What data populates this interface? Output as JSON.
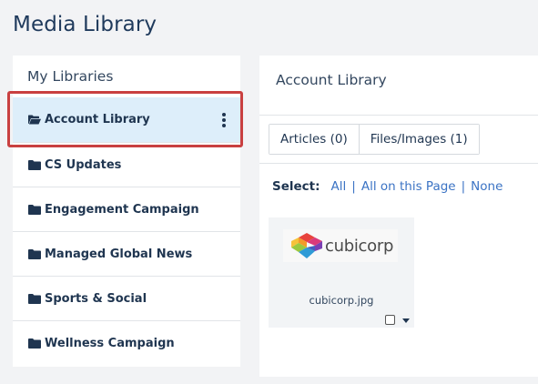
{
  "page": {
    "title": "Media Library"
  },
  "sidebar": {
    "heading": "My Libraries",
    "items": [
      {
        "label": "Account Library",
        "icon": "folder-open-icon",
        "active": true
      },
      {
        "label": "CS Updates",
        "icon": "folder-icon"
      },
      {
        "label": "Engagement Campaign",
        "icon": "folder-icon"
      },
      {
        "label": "Managed Global News",
        "icon": "folder-icon"
      },
      {
        "label": "Sports & Social",
        "icon": "folder-icon"
      },
      {
        "label": "Wellness Campaign",
        "icon": "folder-icon"
      }
    ]
  },
  "main": {
    "title": "Account Library",
    "tabs": [
      {
        "label": "Articles (0)"
      },
      {
        "label": "Files/Images (1)"
      }
    ],
    "select": {
      "label": "Select:",
      "options": [
        "All",
        "All on this Page",
        "None"
      ]
    },
    "files": [
      {
        "name": "cubicorp.jpg",
        "logo_text": "cubicorp"
      }
    ]
  },
  "colors": {
    "accent_link": "#3b73c4",
    "highlight": "#c94040",
    "active_bg": "#ddeefa",
    "text_dark": "#1f3550"
  }
}
